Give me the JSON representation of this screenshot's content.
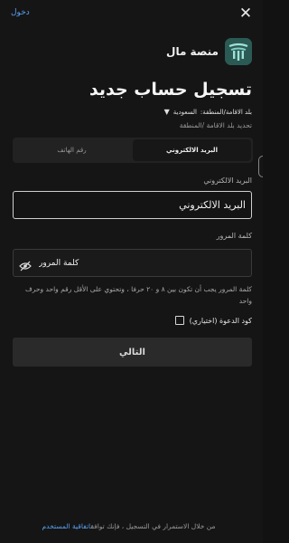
{
  "header": {
    "login_label": "دخول",
    "close_glyph": "✕"
  },
  "brand": {
    "name": "منصة مال",
    "logo_icon": "mal-logo-icon",
    "logo_color": "#2b5a55"
  },
  "page": {
    "title": "تسجيل حساب جديد"
  },
  "country": {
    "label": "بلد الاقامة/المنطقة:",
    "value": "السعودية",
    "caret": "▼",
    "sublabel": "تحديد بلد الاقامة /المنطقة"
  },
  "tabs": [
    {
      "label": "البريد الالكتروني",
      "active": true
    },
    {
      "label": "رقم الهاتف",
      "active": false
    }
  ],
  "email": {
    "label": "البريد الالكتروني",
    "placeholder": "البريد الالكتروني"
  },
  "password": {
    "label": "كلمة المرور",
    "placeholder": "كلمة المرور",
    "toggle_icon": "eye-slash-icon",
    "hint": "كلمة المرور يجب أن تكون بين ٨ و ٢٠ حرفا ، وتحتوي على الأقل رقم واحد وحرف واحد"
  },
  "invite": {
    "label": "كود الدعوة (اختياري)",
    "checked": false
  },
  "actions": {
    "next_label": "التالي"
  },
  "footer": {
    "text": "من خلال الاستمرار في التسجيل ، فإنك توافق",
    "terms_link": "اتفاقية المستخدم"
  },
  "colors": {
    "background": "#151515",
    "accent_link": "#5aa0f0",
    "button_bg": "#2a2a2a"
  }
}
